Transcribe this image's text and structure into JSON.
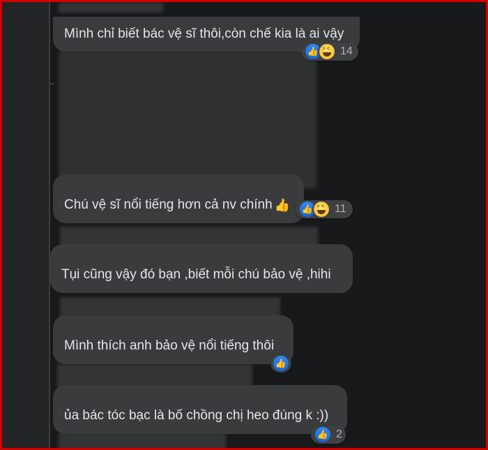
{
  "comments": [
    {
      "text": "Mình chỉ biết bác vệ sĩ thôi,còn chế kia là ai vậy",
      "reactions": [
        "like-icon",
        "haha-icon"
      ],
      "count": "14"
    },
    {
      "text": "Chú vệ sĩ nổi tiếng hơn cả nv chính",
      "emoji": "👍",
      "reactions": [
        "like-icon",
        "haha-icon"
      ],
      "count": "11"
    },
    {
      "text": "Tụi cũng vậy đó bạn ,biết mỗi chú bảo vệ ,hihi",
      "reactions": [],
      "count": ""
    },
    {
      "text": "Mình thích anh bảo vệ nổi tiếng thôi",
      "reactions": [
        "like-icon"
      ],
      "count": ""
    },
    {
      "text": "ủa bác tóc bạc là bố chồng chị heo đúng k :))",
      "reactions": [
        "like-icon"
      ],
      "count": "2"
    }
  ],
  "colors": {
    "frame": "#d40000",
    "background": "#18191a",
    "bubble": "#3a3b3c",
    "text": "#e4e6eb",
    "like": "#1877f2"
  }
}
